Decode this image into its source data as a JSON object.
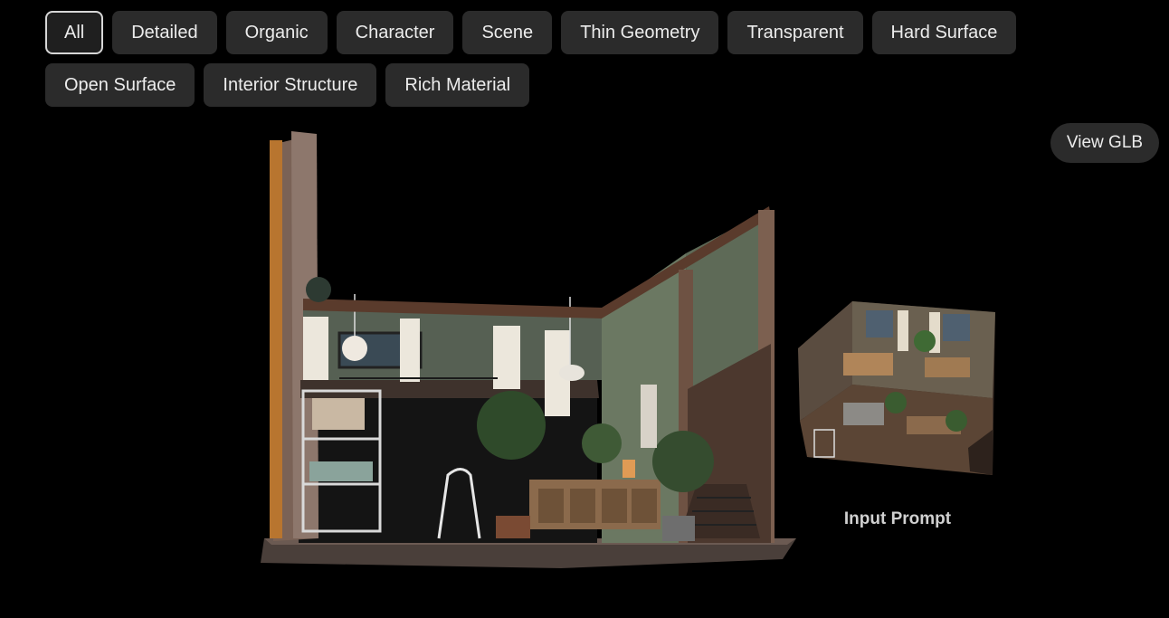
{
  "filters": {
    "row1": [
      "All",
      "Detailed",
      "Organic",
      "Character",
      "Scene",
      "Thin Geometry",
      "Transparent",
      "Hard Surface"
    ],
    "row2": [
      "Open Surface",
      "Interior Structure",
      "Rich Material"
    ],
    "active": "All"
  },
  "toolbar": {
    "view_glb_label": "View GLB"
  },
  "preview": {
    "input_label": "Input Prompt"
  }
}
